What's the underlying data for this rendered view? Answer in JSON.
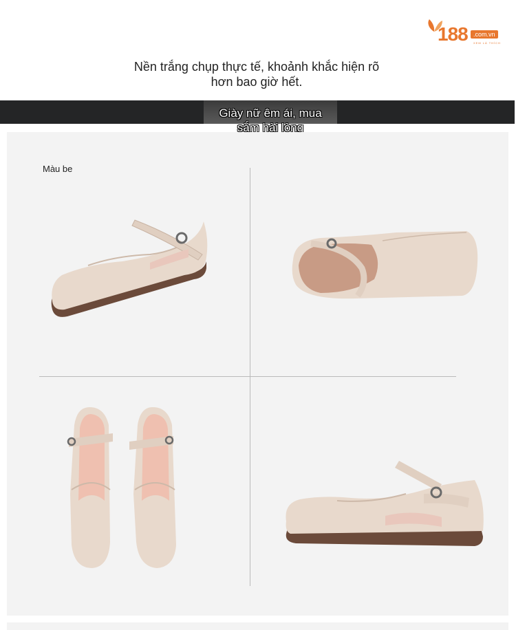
{
  "logo": {
    "number": "188",
    "domain": ".com.vn",
    "tagline": "XEM LÀ THÍCH"
  },
  "intro_line1": "Nền trắng chụp thực tế, khoảnh khắc hiện rõ",
  "intro_line2": "hơn bao giờ hết.",
  "banner_line1": "Giày nữ êm ái, mua",
  "banner_line2": "sắm hài lòng",
  "color_label": "Màu be",
  "colors": {
    "accent": "#e8772e",
    "banner": "#242526",
    "panel": "#f3f3f3",
    "shoe": "#e6d6c9"
  }
}
